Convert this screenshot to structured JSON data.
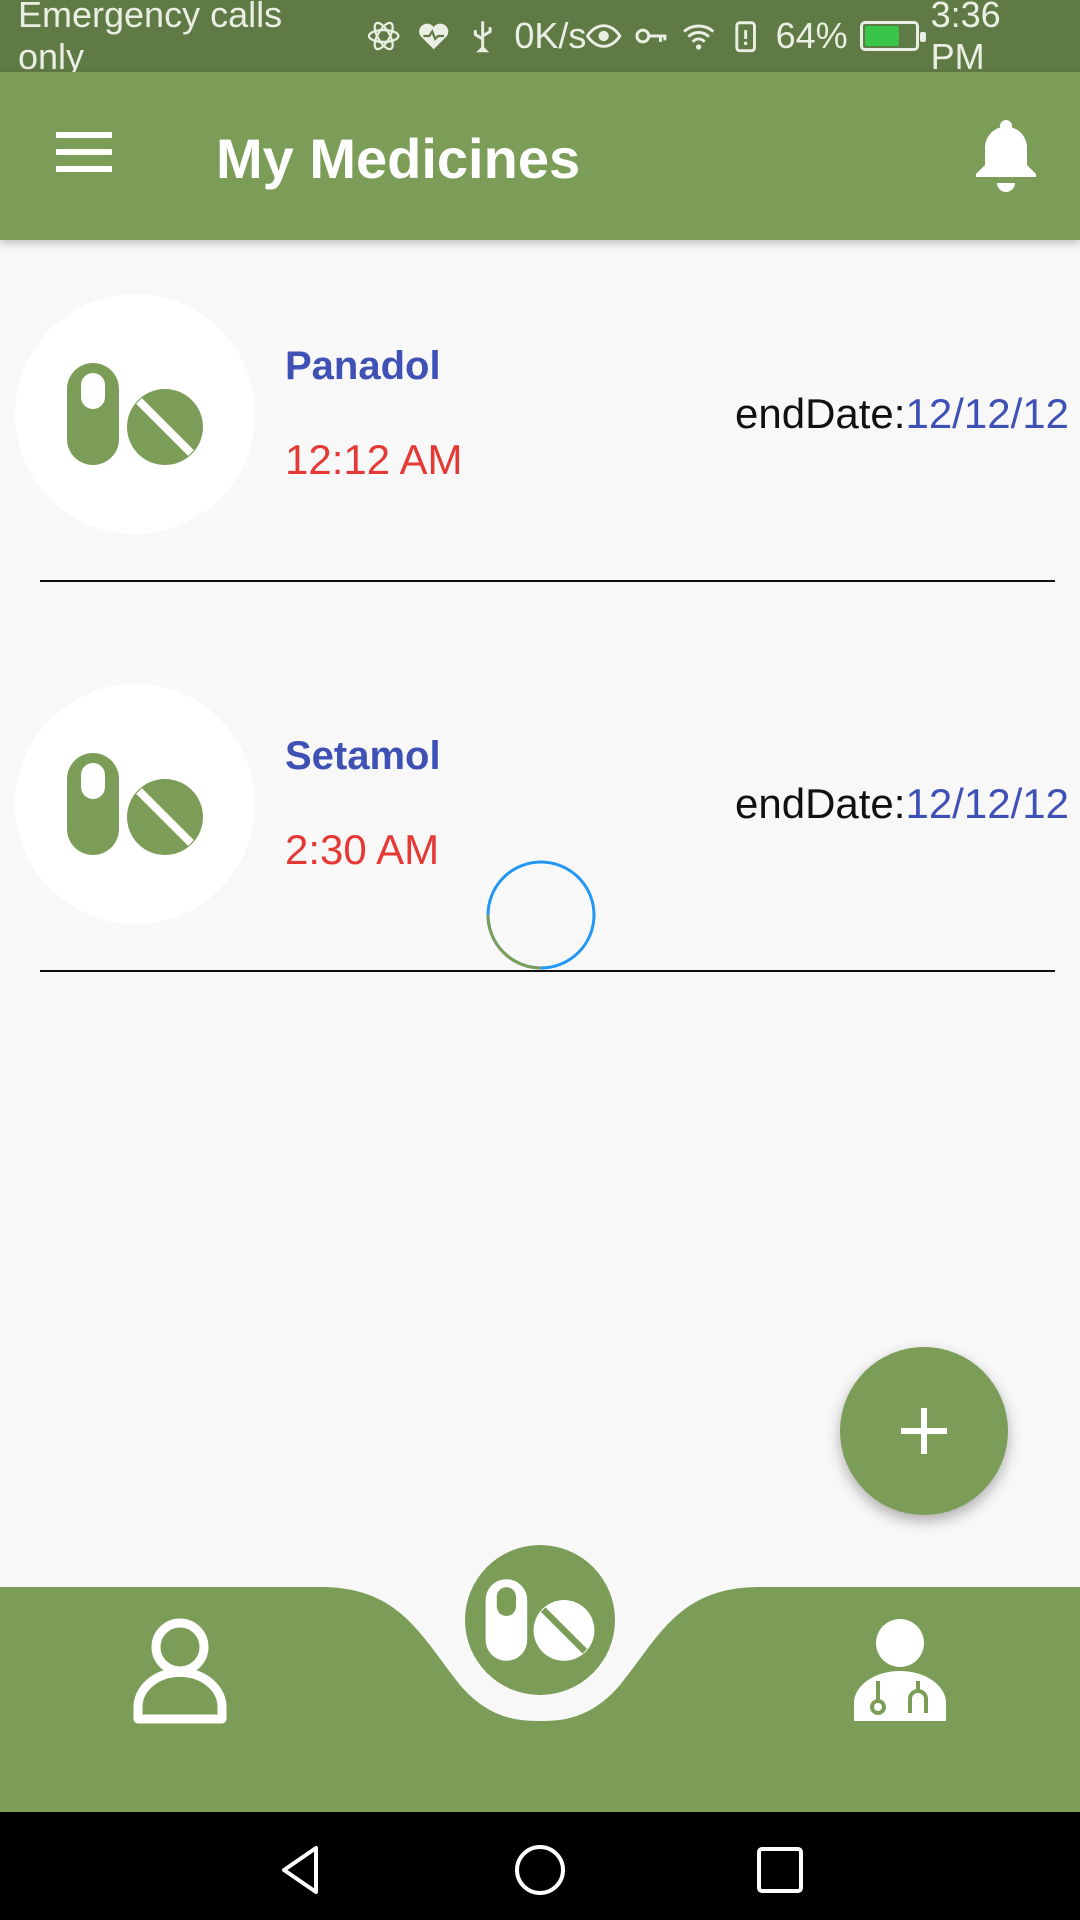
{
  "status_bar": {
    "carrier_text": "Emergency calls only",
    "net_speed": "0K/s",
    "battery": "64%",
    "time": "3:36 PM"
  },
  "app_bar": {
    "title": "My Medicines"
  },
  "medicines": [
    {
      "name": "Panadol",
      "time": "12:12 AM",
      "end_label": "endDate:",
      "end_value": "12/12/12"
    },
    {
      "name": "Setamol",
      "time": "2:30 AM",
      "end_label": "endDate:",
      "end_value": "12/12/12"
    }
  ],
  "icons": {
    "menu": "hamburger-menu-icon",
    "notifications": "bell-icon",
    "medicine": "pills-icon",
    "add": "plus-icon",
    "profile": "user-icon",
    "doctor": "doctor-icon"
  },
  "colors": {
    "primary": "#7b9d58",
    "status_bar": "#5f7a45",
    "name": "#3f51b5",
    "time": "#e53935"
  }
}
